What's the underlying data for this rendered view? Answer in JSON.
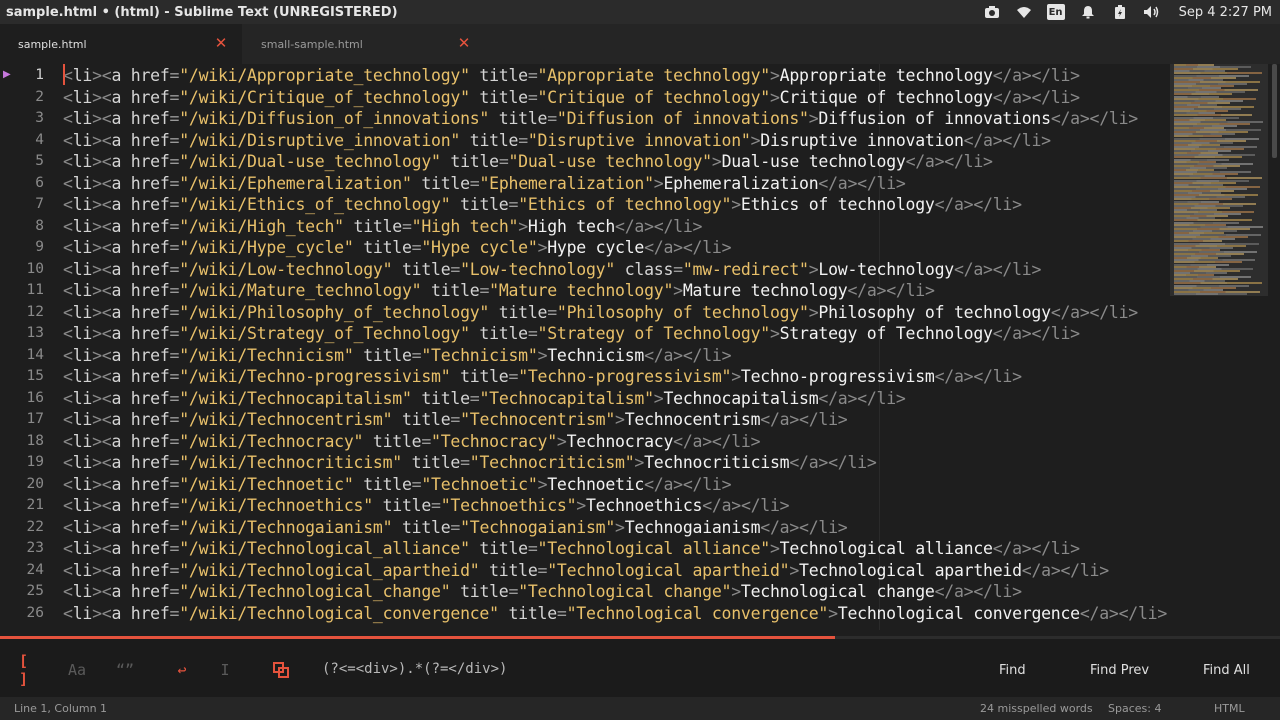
{
  "window": {
    "title": "sample.html • (html) - Sublime Text (UNREGISTERED)"
  },
  "tray": {
    "lang": "En",
    "clock": "Sep 4  2:27 PM"
  },
  "tabs": [
    {
      "label": "sample.html",
      "active": true
    },
    {
      "label": "small-sample.html",
      "active": false
    }
  ],
  "editor": {
    "current_line": 1,
    "lines": [
      {
        "n": "1",
        "slug": "Appropriate_technology",
        "title": "Appropriate technology",
        "cls": "",
        "text": "Appropriate technology"
      },
      {
        "n": "2",
        "slug": "Critique_of_technology",
        "title": "Critique of technology",
        "cls": "",
        "text": "Critique of technology"
      },
      {
        "n": "3",
        "slug": "Diffusion_of_innovations",
        "title": "Diffusion of innovations",
        "cls": "",
        "text": "Diffusion of innovations"
      },
      {
        "n": "4",
        "slug": "Disruptive_innovation",
        "title": "Disruptive innovation",
        "cls": "",
        "text": "Disruptive innovation"
      },
      {
        "n": "5",
        "slug": "Dual-use_technology",
        "title": "Dual-use technology",
        "cls": "",
        "text": "Dual-use technology"
      },
      {
        "n": "6",
        "slug": "Ephemeralization",
        "title": "Ephemeralization",
        "cls": "",
        "text": "Ephemeralization"
      },
      {
        "n": "7",
        "slug": "Ethics_of_technology",
        "title": "Ethics of technology",
        "cls": "",
        "text": "Ethics of technology"
      },
      {
        "n": "8",
        "slug": "High_tech",
        "title": "High tech",
        "cls": "",
        "text": "High tech"
      },
      {
        "n": "9",
        "slug": "Hype_cycle",
        "title": "Hype cycle",
        "cls": "",
        "text": "Hype cycle"
      },
      {
        "n": "10",
        "slug": "Low-technology",
        "title": "Low-technology",
        "cls": "mw-redirect",
        "text": "Low-technology"
      },
      {
        "n": "11",
        "slug": "Mature_technology",
        "title": "Mature technology",
        "cls": "",
        "text": "Mature technology"
      },
      {
        "n": "12",
        "slug": "Philosophy_of_technology",
        "title": "Philosophy of technology",
        "cls": "",
        "text": "Philosophy of technology"
      },
      {
        "n": "13",
        "slug": "Strategy_of_Technology",
        "title": "Strategy of Technology",
        "cls": "",
        "text": "Strategy of Technology"
      },
      {
        "n": "14",
        "slug": "Technicism",
        "title": "Technicism",
        "cls": "",
        "text": "Technicism"
      },
      {
        "n": "15",
        "slug": "Techno-progressivism",
        "title": "Techno-progressivism",
        "cls": "",
        "text": "Techno-progressivism"
      },
      {
        "n": "16",
        "slug": "Technocapitalism",
        "title": "Technocapitalism",
        "cls": "",
        "text": "Technocapitalism"
      },
      {
        "n": "17",
        "slug": "Technocentrism",
        "title": "Technocentrism",
        "cls": "",
        "text": "Technocentrism"
      },
      {
        "n": "18",
        "slug": "Technocracy",
        "title": "Technocracy",
        "cls": "",
        "text": "Technocracy"
      },
      {
        "n": "19",
        "slug": "Technocriticism",
        "title": "Technocriticism",
        "cls": "",
        "text": "Technocriticism"
      },
      {
        "n": "20",
        "slug": "Technoetic",
        "title": "Technoetic",
        "cls": "",
        "text": "Technoetic"
      },
      {
        "n": "21",
        "slug": "Technoethics",
        "title": "Technoethics",
        "cls": "",
        "text": "Technoethics"
      },
      {
        "n": "22",
        "slug": "Technogaianism",
        "title": "Technogaianism",
        "cls": "",
        "text": "Technogaianism"
      },
      {
        "n": "23",
        "slug": "Technological_alliance",
        "title": "Technological alliance",
        "cls": "",
        "text": "Technological alliance"
      },
      {
        "n": "24",
        "slug": "Technological_apartheid",
        "title": "Technological apartheid",
        "cls": "",
        "text": "Technological apartheid"
      },
      {
        "n": "25",
        "slug": "Technological_change",
        "title": "Technological change",
        "cls": "",
        "text": "Technological change"
      },
      {
        "n": "26",
        "slug": "Technological_convergence",
        "title": "Technological convergence",
        "cls": "",
        "text": "Technological convergence"
      }
    ]
  },
  "find": {
    "query": "(?<=<div>).*(?=</div>)",
    "find_label": "Find",
    "find_prev_label": "Find Prev",
    "find_all_label": "Find All",
    "icons": [
      "regex-icon",
      "case-sensitive-icon",
      "whole-word-icon",
      "wrap-icon",
      "in-selection-icon",
      "highlight-matches-icon"
    ]
  },
  "status": {
    "position": "Line 1, Column 1",
    "spelling": "24 misspelled words",
    "spaces": "Spaces: 4",
    "syntax": "HTML"
  },
  "colors": {
    "accent": "#e5533d",
    "string": "#e8c06a",
    "background": "#1e1e1e"
  }
}
